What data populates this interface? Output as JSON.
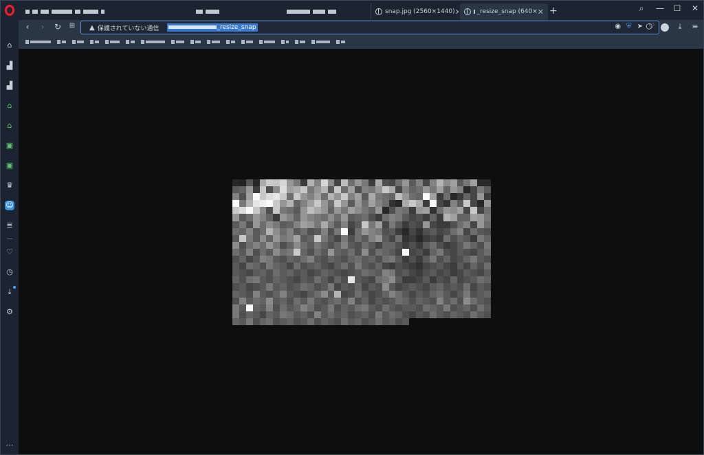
{
  "tabs": {
    "snap_label": "snap.jpg (2560×1440)",
    "active_label": "_resize_snap (640×",
    "close_glyph": "✕",
    "new_tab_glyph": "+"
  },
  "window_controls": {
    "search": "⌕",
    "minimize": "—",
    "maximize": "☐",
    "close": "✕"
  },
  "address_bar": {
    "security_warning": "保護されていない通信",
    "url_visible_suffix": "_resize_snap"
  },
  "icons": {
    "back": "chevron-left-icon",
    "forward": "chevron-right-icon",
    "reload": "reload-icon",
    "tabs_grid": "grid-icon",
    "warning": "warning-triangle-icon",
    "camera": "camera-icon",
    "shield": "shield-icon",
    "send": "send-icon",
    "heart": "heart-icon"
  },
  "colors": {
    "accent": "#3a79c9",
    "opera_red": "#ff1b2d",
    "chrome": "#1b2430",
    "toolbar": "#2b3644",
    "page_bg": "#0e0e0f"
  },
  "image": {
    "grayscale": [
      38,
      34,
      85,
      40,
      170,
      205,
      200,
      215,
      150,
      120,
      60,
      180,
      130,
      215,
      140,
      70,
      190,
      110,
      150,
      120,
      60,
      170,
      80,
      70,
      110,
      150,
      90,
      130,
      70,
      130,
      180,
      140,
      160,
      90,
      120,
      160,
      40,
      40,
      90,
      100,
      150,
      60,
      200,
      80,
      140,
      220,
      160,
      170,
      200,
      120,
      150,
      180,
      90,
      200,
      110,
      160,
      80,
      130,
      120,
      150,
      200,
      170,
      70,
      130,
      100,
      110,
      150,
      120,
      160,
      100,
      150,
      130,
      40,
      70,
      120,
      90,
      130,
      80,
      160,
      250,
      200,
      220,
      230,
      200,
      110,
      200,
      150,
      130,
      160,
      110,
      180,
      150,
      200,
      130,
      160,
      90,
      170,
      120,
      110,
      100,
      190,
      150,
      110,
      100,
      250,
      160,
      60,
      110,
      40,
      60,
      100,
      70,
      150,
      60,
      250,
      120,
      180,
      230,
      240,
      250,
      200,
      150,
      180,
      100,
      130,
      160,
      200,
      150,
      110,
      200,
      150,
      90,
      150,
      110,
      160,
      130,
      110,
      50,
      40,
      170,
      200,
      170,
      60,
      250,
      70,
      50,
      130,
      90,
      200,
      70,
      40,
      150,
      200,
      220,
      250,
      200,
      140,
      80,
      200,
      120,
      110,
      90,
      150,
      190,
      170,
      150,
      100,
      150,
      120,
      160,
      140,
      120,
      100,
      150,
      40,
      80,
      120,
      110,
      60,
      150,
      160,
      50,
      110,
      150,
      140,
      160,
      70,
      200,
      70,
      110,
      150,
      90,
      110,
      150,
      130,
      100,
      60,
      150,
      130,
      100,
      150,
      130,
      120,
      110,
      140,
      110,
      150,
      90,
      100,
      110,
      80,
      60,
      110,
      130,
      120,
      90,
      70,
      80,
      60,
      100,
      60,
      180,
      160,
      100,
      100,
      160,
      150,
      120,
      90,
      120,
      80,
      150,
      110,
      140,
      120,
      90,
      100,
      130,
      160,
      150,
      120,
      170,
      120,
      90,
      130,
      70,
      90,
      200,
      120,
      160,
      70,
      120,
      90,
      60,
      80,
      70,
      150,
      70,
      60,
      60,
      80,
      110,
      130,
      70,
      150,
      110,
      110,
      100,
      130,
      90,
      110,
      180,
      140,
      110,
      130,
      90,
      110,
      80,
      90,
      130,
      80,
      120,
      250,
      60,
      110,
      150,
      130,
      120,
      80,
      90,
      60,
      40,
      70,
      50,
      80,
      90,
      70,
      80,
      110,
      130,
      70,
      110,
      90,
      80,
      90,
      200,
      120,
      90,
      140,
      100,
      150,
      120,
      130,
      160,
      90,
      100,
      200,
      120,
      90,
      70,
      120,
      80,
      110,
      90,
      130,
      150,
      90,
      70,
      110,
      50,
      60,
      40,
      60,
      70,
      60,
      110,
      80,
      100,
      90,
      60,
      120,
      100,
      140,
      80,
      110,
      130,
      110,
      150,
      120,
      80,
      100,
      140,
      110,
      90,
      120,
      100,
      80,
      100,
      130,
      90,
      80,
      110,
      90,
      70,
      100,
      100,
      80,
      60,
      80,
      60,
      90,
      110,
      80,
      60,
      70,
      90,
      120,
      100,
      80,
      120,
      110,
      90,
      130,
      80,
      110,
      90,
      140,
      110,
      120,
      200,
      100,
      80,
      110,
      90,
      150,
      100,
      90,
      110,
      80,
      140,
      80,
      110,
      100,
      90,
      70,
      250,
      70,
      80,
      60,
      100,
      120,
      80,
      70,
      90,
      80,
      70,
      90,
      110,
      80,
      100,
      70,
      90,
      130,
      120,
      90,
      80,
      100,
      90,
      110,
      130,
      90,
      80,
      100,
      90,
      80,
      100,
      110,
      90,
      100,
      80,
      110,
      120,
      90,
      60,
      80,
      60,
      90,
      120,
      80,
      100,
      70,
      80,
      100,
      120,
      90,
      80,
      90,
      70,
      110,
      100,
      80,
      120,
      100,
      90,
      70,
      110,
      80,
      90,
      100,
      80,
      70,
      90,
      110,
      80,
      120,
      90,
      80,
      100,
      70,
      60,
      80,
      70,
      60,
      50,
      70,
      80,
      90,
      70,
      60,
      90,
      70,
      100,
      80,
      110,
      90,
      80,
      70,
      90,
      100,
      80,
      110,
      90,
      100,
      80,
      90,
      70,
      80,
      100,
      90,
      80,
      70,
      80,
      90,
      110,
      100,
      90,
      130,
      120,
      80,
      90,
      70,
      60,
      80,
      90,
      70,
      80,
      60,
      70,
      90,
      80,
      70,
      90,
      100,
      80,
      110,
      120,
      90,
      80,
      100,
      90,
      80,
      70,
      90,
      80,
      110,
      90,
      70,
      100,
      80,
      230,
      90,
      80,
      70,
      110,
      120,
      140,
      90,
      60,
      60,
      70,
      90,
      60,
      80,
      70,
      100,
      70,
      80,
      90,
      110,
      100,
      80,
      90,
      70,
      80,
      90,
      120,
      90,
      100,
      80,
      90,
      110,
      100,
      80,
      90,
      120,
      70,
      90,
      80,
      100,
      70,
      90,
      80,
      140,
      90,
      70,
      80,
      90,
      80,
      70,
      90,
      100,
      80,
      90,
      80,
      110,
      70,
      90,
      80,
      100,
      90,
      80,
      130,
      90,
      80,
      100,
      130,
      90,
      80,
      70,
      90,
      110,
      140,
      90,
      180,
      70,
      80,
      110,
      90,
      70,
      80,
      100,
      130,
      110,
      90,
      70,
      90,
      80,
      100,
      110,
      90,
      70,
      90,
      120,
      80,
      90,
      100,
      80,
      130,
      90,
      110,
      100,
      140,
      90,
      100,
      80,
      110,
      90,
      120,
      90,
      80,
      100,
      110,
      90,
      130,
      80,
      100,
      70,
      90,
      80,
      90,
      110,
      100,
      80,
      100,
      90,
      80,
      130,
      90,
      110,
      80,
      140,
      110,
      90,
      80,
      120,
      90,
      250,
      100,
      90,
      130,
      80,
      110,
      90,
      100,
      130,
      110,
      80,
      90,
      120,
      80,
      100,
      90,
      110,
      120,
      90,
      80,
      110,
      90,
      80,
      90,
      90,
      80,
      110,
      100,
      90,
      120,
      80,
      90,
      100,
      80,
      110,
      90,
      120,
      80,
      100,
      90,
      70,
      100,
      90,
      120,
      110,
      90,
      100,
      80,
      130,
      90,
      110,
      90,
      100,
      80,
      90,
      100,
      80,
      120,
      90,
      110,
      100,
      80,
      70,
      90,
      80,
      110,
      90,
      80,
      100,
      90,
      80,
      110,
      90,
      80,
      100,
      90,
      120,
      80,
      100,
      110,
      80,
      90,
      100,
      80,
      90,
      110,
      80,
      100,
      90,
      80,
      110,
      90,
      100,
      80,
      90,
      110,
      90,
      100,
      80,
      90
    ]
  }
}
